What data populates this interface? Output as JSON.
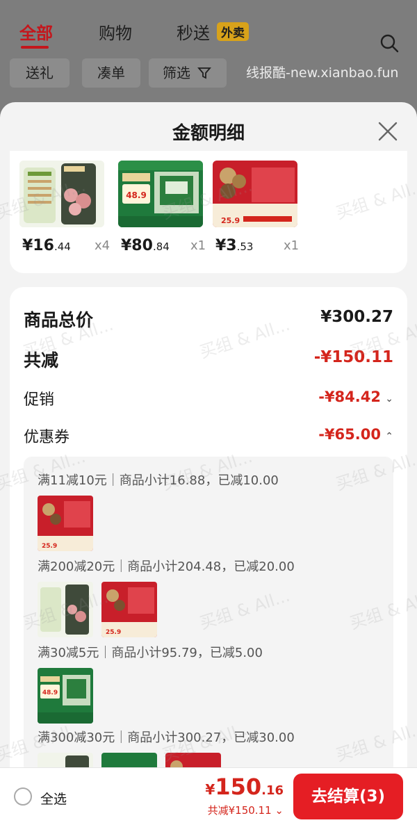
{
  "background_page": {
    "tabs": [
      {
        "label": "全部",
        "active": true
      },
      {
        "label": "购物",
        "active": false
      },
      {
        "label": "秒送",
        "active": false
      }
    ],
    "waimai_badge": "外卖",
    "filters": [
      "送礼",
      "凑单",
      "筛选"
    ],
    "watermark": "线报酷-new.xianbao.fun"
  },
  "sheet": {
    "title": "金额明细",
    "products": [
      {
        "price_int": "¥16",
        "price_dec": ".44",
        "qty": "x4"
      },
      {
        "price_int": "¥80",
        "price_dec": ".84",
        "qty": "x1",
        "img_text": "48.9"
      },
      {
        "price_int": "¥3",
        "price_dec": ".53",
        "qty": "x1",
        "img_text": "25.9"
      }
    ],
    "summary": {
      "total_label": "商品总价",
      "total_value": "¥300.27",
      "discount_label": "共减",
      "discount_value": "-¥150.11",
      "promo_label": "促销",
      "promo_value": "-¥84.42",
      "coupon_label": "优惠券",
      "coupon_value": "-¥65.00"
    },
    "coupons": [
      {
        "text": "满11减10元｜商品小计16.88，已减10.00"
      },
      {
        "text": "满200减20元｜商品小计204.48，已减20.00"
      },
      {
        "text": "满30减5元｜商品小计95.79，已减5.00"
      },
      {
        "text": "满300减30元｜商品小计300.27，已减30.00"
      }
    ],
    "thumb_labels": {
      "price_a": "25.9",
      "price_b": "48.9"
    }
  },
  "bottom_bar": {
    "select_all": "全选",
    "price_cur": "¥",
    "price_int": "150",
    "price_dec": ".16",
    "saved": "共减¥150.11",
    "checkout": "去结算(3)"
  },
  "watermark_text": "买组 & All...",
  "colors": {
    "accent": "#e51e24",
    "price_red": "#d4251c",
    "brand_red": "#c4161c"
  }
}
